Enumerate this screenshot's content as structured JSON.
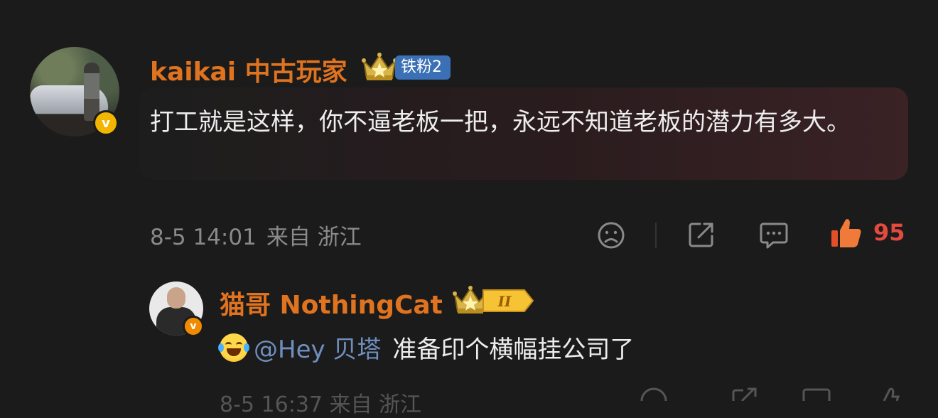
{
  "comment": {
    "author": "kaikai 中古玩家",
    "fan_badge": "铁粉2",
    "text": "打工就是这样，你不逼老板一把，永远不知道老板的潜力有多大。",
    "time": "8-5 14:01",
    "location": "来自 浙江",
    "like_count": "95",
    "icons": [
      "dislike-icon",
      "share-icon",
      "reply-icon",
      "like-icon"
    ]
  },
  "reply": {
    "author": "猫哥 NothingCat",
    "rank_badge": "II",
    "emoji": "laughing-tears-emoji",
    "mention": "@Hey 贝塔",
    "text": "准备印个横幅挂公司了",
    "partial_meta": "8-5 16:37 来自 浙江"
  },
  "colors": {
    "background": "#1b1b1b",
    "name": "#e0731f",
    "mention": "#6f8fbf",
    "like": "#e64a3f",
    "meta": "#8a8a8a",
    "verified_main": "#f2b600",
    "verified_sub": "#f08a00",
    "fan_badge": "#3b6fb6"
  }
}
